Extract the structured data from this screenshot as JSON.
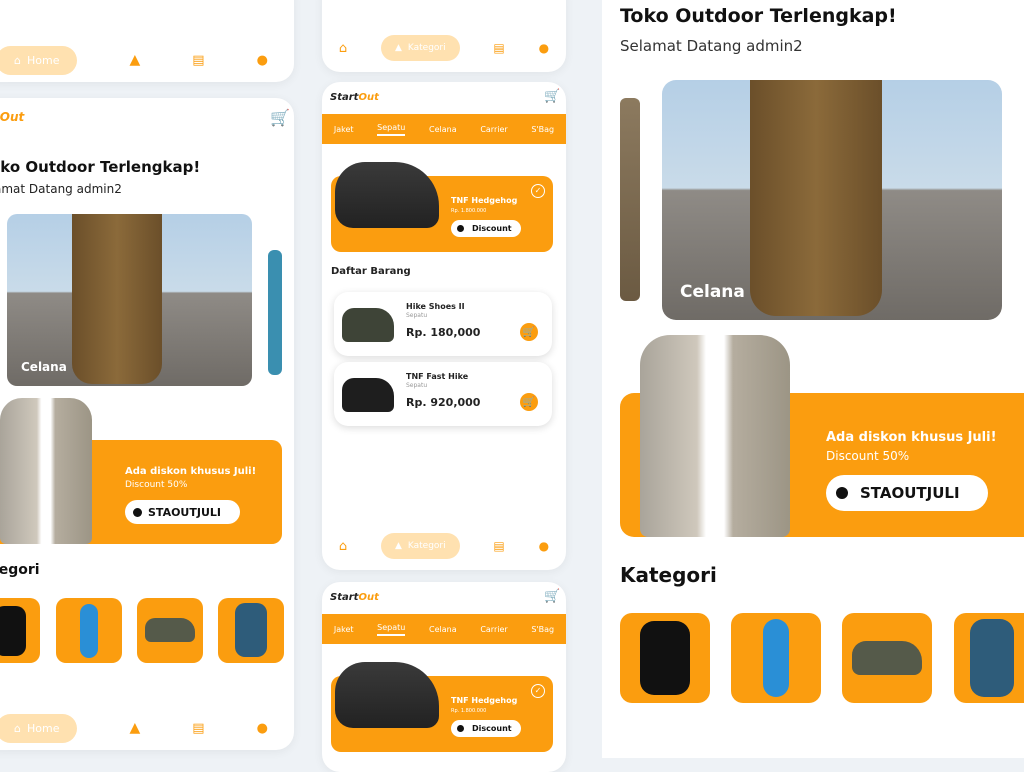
{
  "brand": {
    "start": "Start",
    "out": "Out"
  },
  "nav": {
    "home": "Home",
    "kategori": "Kategori"
  },
  "tabs": [
    "Jaket",
    "Sepatu",
    "Celana",
    "Carrier",
    "S'Bag"
  ],
  "home": {
    "title": "Toko Outdoor Terlengkap!",
    "welcome": "Selamat Datang admin2",
    "banner_label": "Celana",
    "promo_title": "Ada diskon khusus Juli!",
    "promo_sub": "Discount 50%",
    "promo_code": "STAOUTJULI",
    "section_kategori": "Kategori"
  },
  "left": {
    "title": "oko Outdoor Terlengkap!",
    "welcome": "amat Datang admin2",
    "section_kategori": "tegori",
    "logo_tail": "t",
    "logo_out": "Out"
  },
  "featured": {
    "name": "TNF Hedgehog",
    "price": "Rp. 1.800.000",
    "discount_label": "Discount"
  },
  "daftar_title": "Daftar Barang",
  "items": [
    {
      "name": "Hike Shoes II",
      "category": "Sepatu",
      "price": "Rp. 180,000"
    },
    {
      "name": "TNF Fast Hike",
      "category": "Sepatu",
      "price": "Rp. 920,000"
    }
  ],
  "colors": {
    "accent": "#fb9d0f",
    "accent_light": "#ffe1b0"
  }
}
